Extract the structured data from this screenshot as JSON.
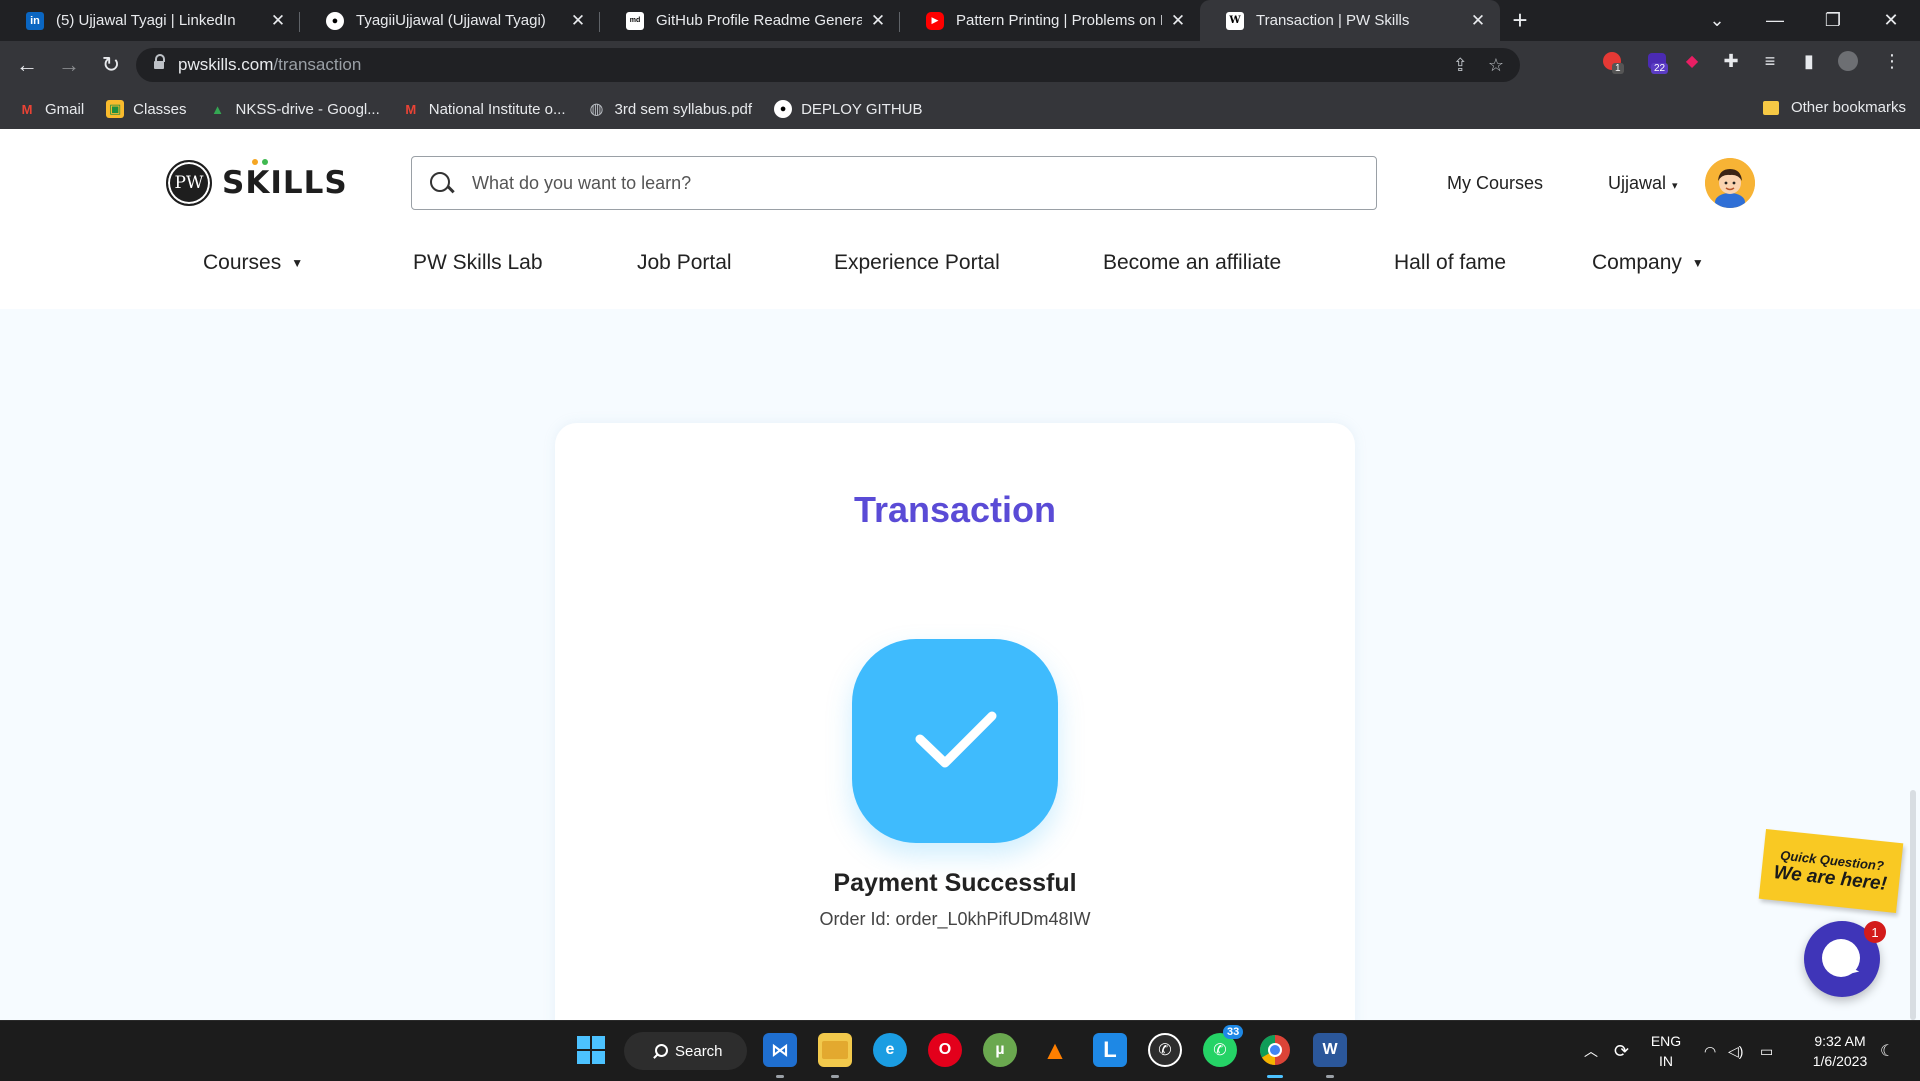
{
  "browser": {
    "tabs": [
      {
        "title": "(5) Ujjawal Tyagi | LinkedIn",
        "icon": "linkedin-icon"
      },
      {
        "title": "TyagiiUjjawal (Ujjawal Tyagi)",
        "icon": "github-icon"
      },
      {
        "title": "GitHub Profile Readme Generator",
        "icon": "readme-generator-icon"
      },
      {
        "title": "Pattern Printing | Problems on Loops",
        "icon": "youtube-icon"
      },
      {
        "title": "Transaction | PW Skills",
        "icon": "pwskills-icon"
      }
    ],
    "active_tab": 4,
    "url_domain": "pwskills.com",
    "url_path": "/transaction",
    "extension_badges": [
      "1",
      "22"
    ],
    "bookmarks": [
      {
        "label": "Gmail",
        "icon": "gmail-icon"
      },
      {
        "label": "Classes",
        "icon": "classroom-icon"
      },
      {
        "label": "NKSS-drive - Googl...",
        "icon": "google-drive-icon"
      },
      {
        "label": "National Institute o...",
        "icon": "gmail-icon"
      },
      {
        "label": "3rd sem syllabus.pdf",
        "icon": "globe-icon"
      },
      {
        "label": "DEPLOY GITHUB",
        "icon": "github-icon"
      }
    ],
    "other_bookmarks": "Other bookmarks"
  },
  "site": {
    "logo_text": "SKILLS",
    "logo_mark": "PW",
    "search_placeholder": "What do you want to learn?",
    "my_courses": "My Courses",
    "user_name": "Ujjawal",
    "nav": [
      "Courses",
      "PW Skills Lab",
      "Job Portal",
      "Experience Portal",
      "Become an affiliate",
      "Hall of fame",
      "Company"
    ]
  },
  "transaction": {
    "heading": "Transaction",
    "status": "Payment Successful",
    "order_id": "Order Id: order_L0khPifUDm48IW"
  },
  "widget": {
    "line1": "Quick Question?",
    "line2": "We are here!",
    "chat_badge": "1"
  },
  "taskbar": {
    "search_label": "Search",
    "whatsapp_badge": "33",
    "lang_line1": "ENG",
    "lang_line2": "IN",
    "time": "9:32 AM",
    "date": "1/6/2023"
  },
  "colors": {
    "accent_purple": "#5a4bd6",
    "success_blue": "#3fbbfd",
    "chat_purple": "#3f35b8"
  }
}
